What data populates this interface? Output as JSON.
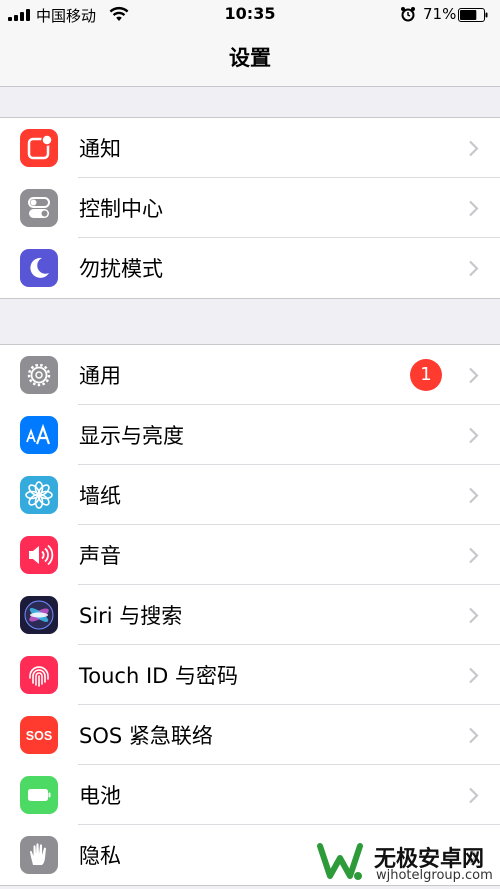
{
  "status_bar": {
    "carrier": "中国移动",
    "time": "10:35",
    "battery_percent": "71%",
    "battery_level": 0.71
  },
  "nav": {
    "title": "设置"
  },
  "groups": [
    {
      "rows": [
        {
          "label": "通知",
          "icon": "notifications-icon",
          "color": "#ff3b30"
        },
        {
          "label": "控制中心",
          "icon": "control-center-icon",
          "color": "#8e8e93"
        },
        {
          "label": "勿扰模式",
          "icon": "moon-icon",
          "color": "#5856d6"
        }
      ]
    },
    {
      "rows": [
        {
          "label": "通用",
          "icon": "gear-icon",
          "color": "#8e8e93",
          "badge": "1"
        },
        {
          "label": "显示与亮度",
          "icon": "text-size-icon",
          "color": "#007aff"
        },
        {
          "label": "墙纸",
          "icon": "flower-icon",
          "color": "#35aadc"
        },
        {
          "label": "声音",
          "icon": "speaker-icon",
          "color": "#ff2d55"
        },
        {
          "label": "Siri 与搜索",
          "icon": "siri-icon",
          "color": "#1c1c3a"
        },
        {
          "label": "Touch ID 与密码",
          "icon": "fingerprint-icon",
          "color": "#ff2d55"
        },
        {
          "label": "SOS 紧急联络",
          "icon": "sos-icon",
          "color": "#ff3b30",
          "icon_text": "SOS"
        },
        {
          "label": "电池",
          "icon": "battery-icon",
          "color": "#4cd964"
        },
        {
          "label": "隐私",
          "icon": "hand-icon",
          "color": "#8e8e93"
        }
      ]
    }
  ],
  "watermark": {
    "brand": "无极安卓网",
    "url": "wjhotelgroup.com"
  }
}
